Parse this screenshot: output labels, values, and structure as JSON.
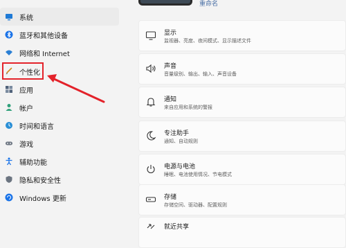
{
  "profile": {
    "rename_link": "重命名"
  },
  "sidebar": {
    "items": [
      {
        "label": "系统",
        "icon": "monitor-icon"
      },
      {
        "label": "蓝牙和其他设备",
        "icon": "bluetooth-icon"
      },
      {
        "label": "网络和 Internet",
        "icon": "wifi-icon"
      },
      {
        "label": "个性化",
        "icon": "brush-icon"
      },
      {
        "label": "应用",
        "icon": "apps-icon"
      },
      {
        "label": "帐户",
        "icon": "person-icon"
      },
      {
        "label": "时间和语言",
        "icon": "globe-clock-icon"
      },
      {
        "label": "游戏",
        "icon": "gamepad-icon"
      },
      {
        "label": "辅助功能",
        "icon": "accessibility-icon"
      },
      {
        "label": "隐私和安全性",
        "icon": "shield-icon"
      },
      {
        "label": "Windows 更新",
        "icon": "update-icon"
      }
    ]
  },
  "settings": {
    "cards": [
      {
        "title": "显示",
        "subtitle": "监视器、亮度、夜间模式、显示描述文件",
        "icon": "display-icon"
      },
      {
        "title": "声音",
        "subtitle": "音量级别、输出、输入、声音设备",
        "icon": "speaker-icon"
      },
      {
        "title": "通知",
        "subtitle": "来自应用和系统的警报",
        "icon": "bell-icon"
      },
      {
        "title": "专注助手",
        "subtitle": "通知、自动规则",
        "icon": "moon-icon"
      },
      {
        "title": "电源与电池",
        "subtitle": "睡眠、电池使用情况、节电模式",
        "icon": "power-icon"
      },
      {
        "title": "存储",
        "subtitle": "存储空间、驱动器、配置规则",
        "icon": "storage-icon"
      },
      {
        "title": "就近共享",
        "subtitle": "",
        "icon": "share-icon"
      }
    ]
  },
  "colors": {
    "accent": "#0067c0",
    "annotation": "#e3222a"
  }
}
